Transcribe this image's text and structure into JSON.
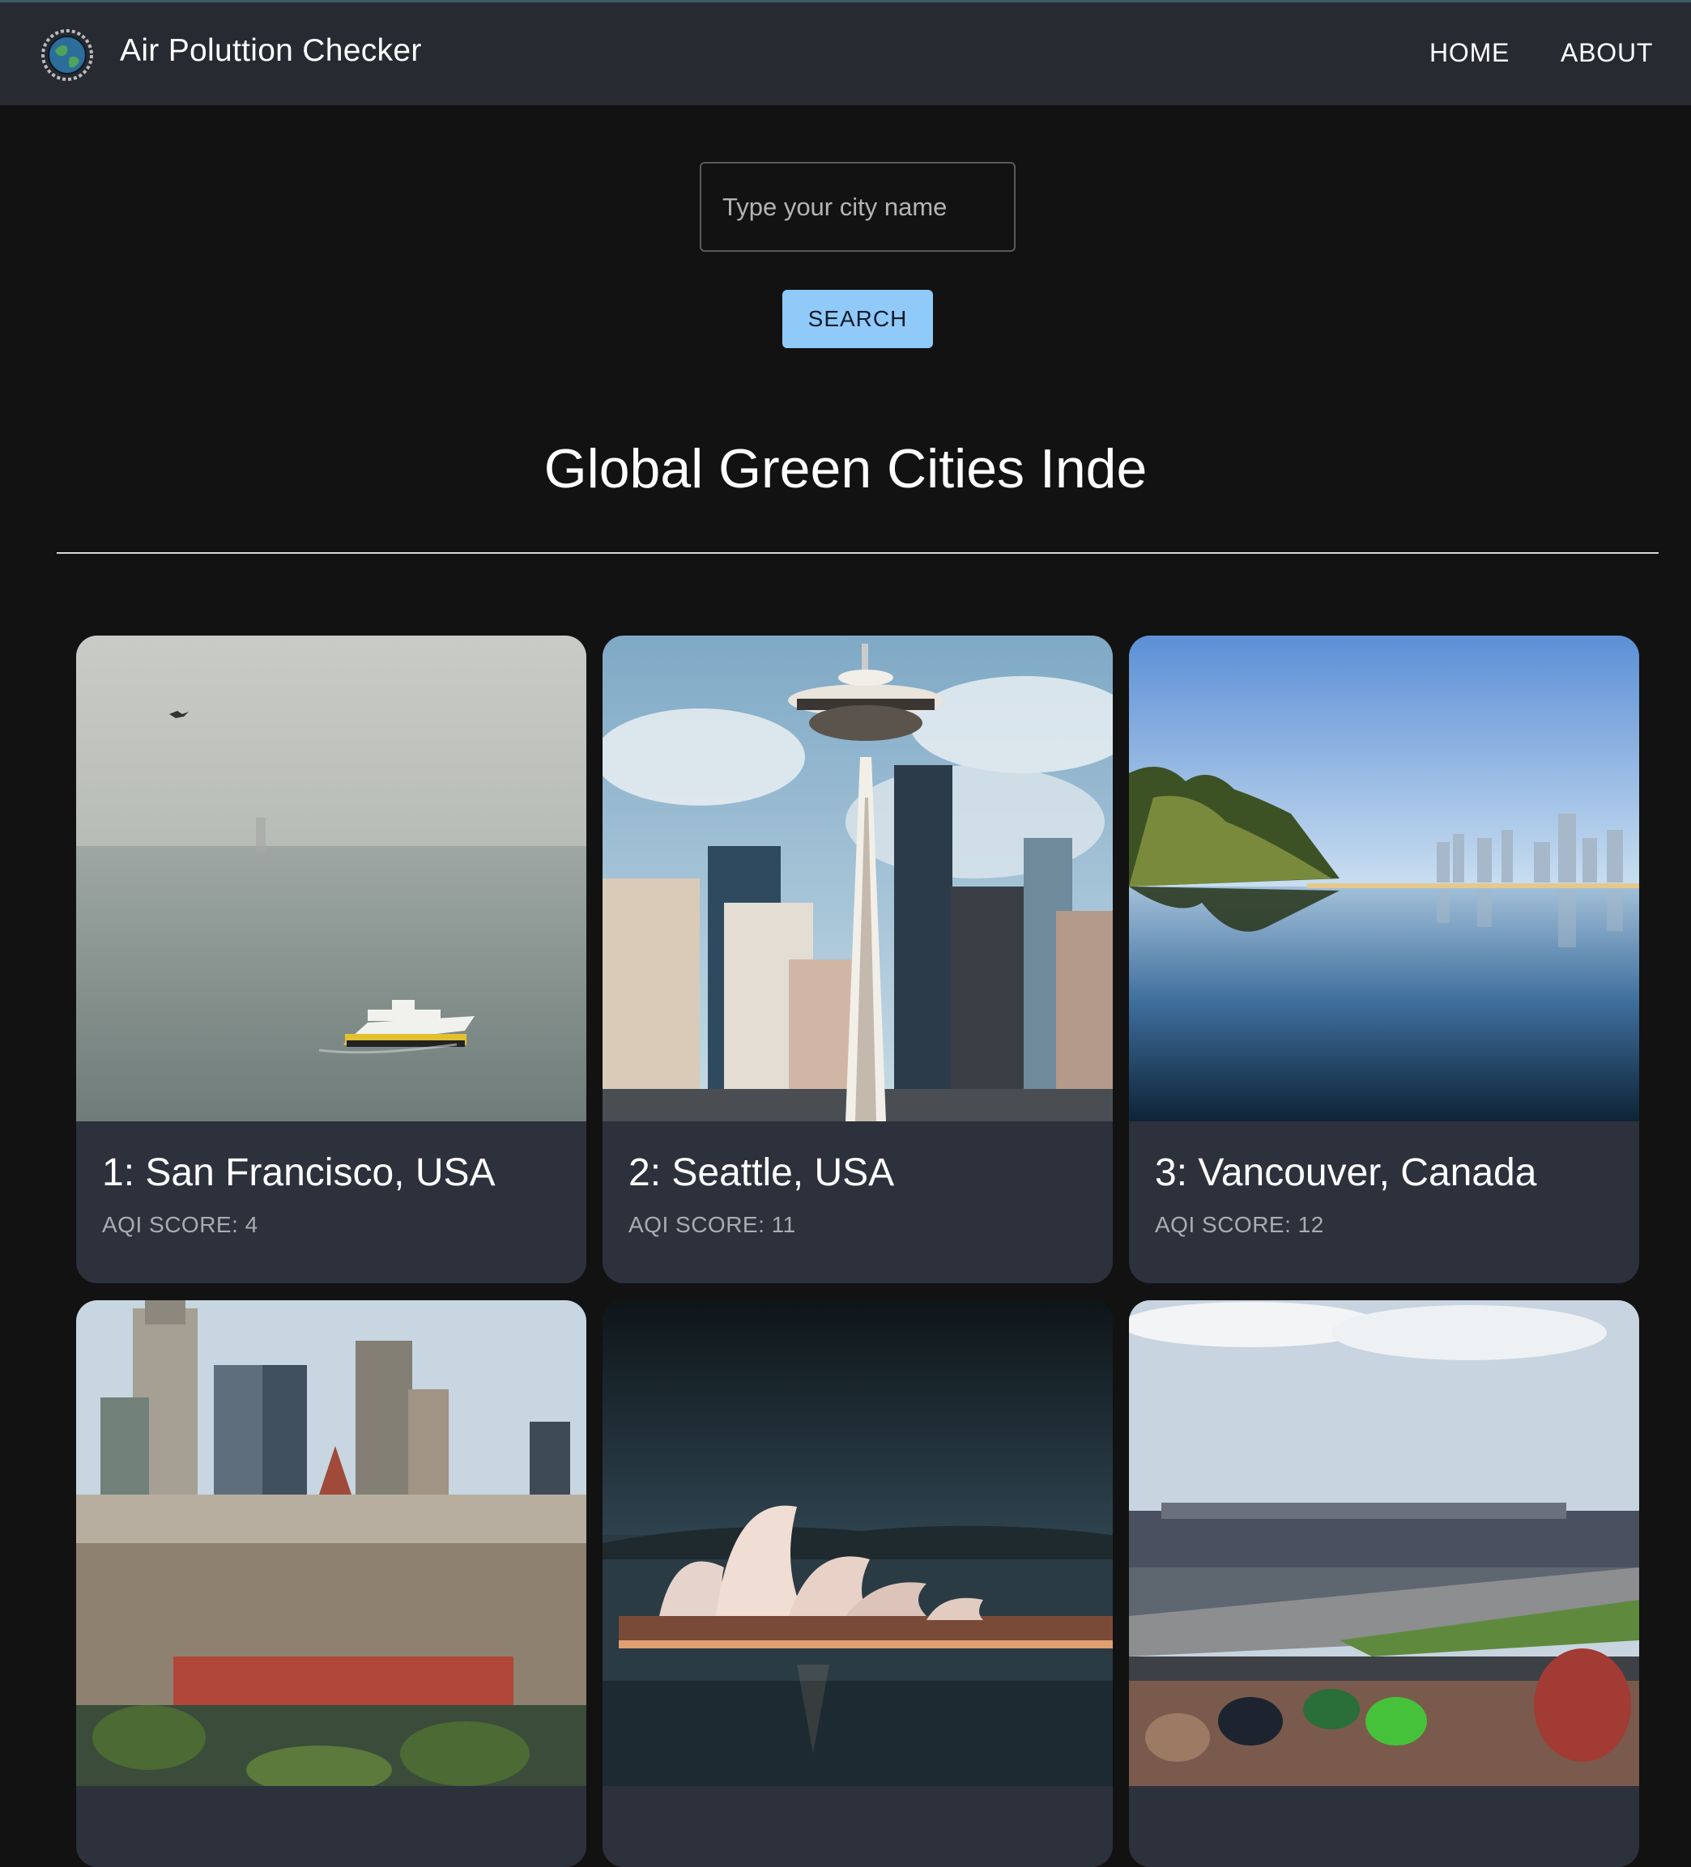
{
  "appbar": {
    "title": "Air Poluttion Checker",
    "logo_icon": "globe-logo-icon",
    "nav": [
      {
        "label": "HOME"
      },
      {
        "label": "ABOUT"
      }
    ]
  },
  "search": {
    "placeholder": "Type your city name",
    "value": "",
    "button_label": "SEARCH"
  },
  "section": {
    "title": "Global Green Cities Inde"
  },
  "cities": [
    {
      "rank_title": "1: San Francisco, USA",
      "aqi": "AQI SCORE: 4",
      "image": "foggy-bay-ferry-photo"
    },
    {
      "rank_title": "2: Seattle, USA",
      "aqi": "AQI SCORE: 11",
      "image": "space-needle-skyline-photo"
    },
    {
      "rank_title": "3: Vancouver, Canada",
      "aqi": "AQI SCORE: 12",
      "image": "harbor-reflection-photo"
    },
    {
      "image": "melbourne-skyline-photo"
    },
    {
      "image": "sydney-opera-house-photo"
    },
    {
      "image": "racetrack-crowd-photo"
    }
  ],
  "colors": {
    "background": "#121212",
    "appbar": "#272a31",
    "card": "#2d313c",
    "button": "#90caf9"
  }
}
